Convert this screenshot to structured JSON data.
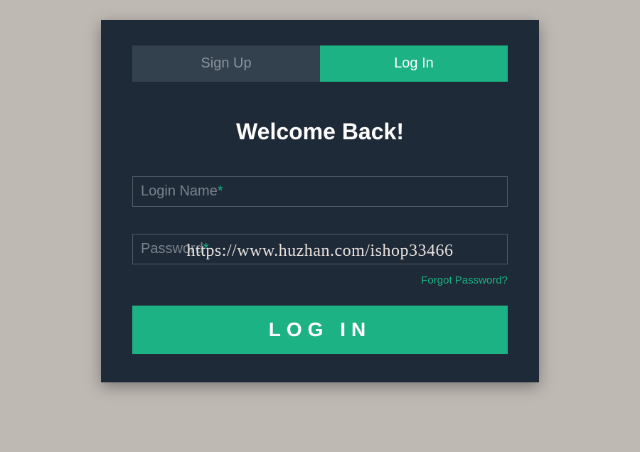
{
  "tabs": {
    "signup": "Sign Up",
    "login": "Log In"
  },
  "heading": "Welcome Back!",
  "fields": {
    "login_name": {
      "label": "Login Name"
    },
    "password": {
      "label": "Password"
    },
    "required_mark": "*"
  },
  "forgot_link": "Forgot Password?",
  "submit_label": "Log In",
  "watermark": "https://www.huzhan.com/ishop33466"
}
